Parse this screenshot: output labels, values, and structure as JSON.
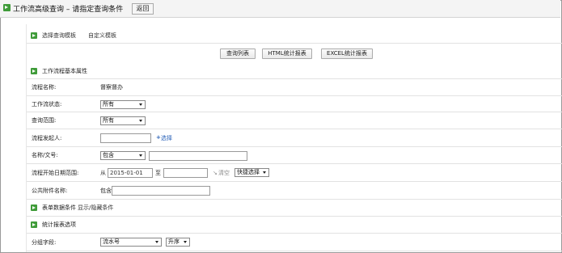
{
  "header": {
    "title": "工作流高级查询 – 请指定查询条件",
    "back_label": "返回"
  },
  "template_row": {
    "select_template": "选择查询模板",
    "custom_template": "自定义模板"
  },
  "actions": {
    "query_list": "查询列表",
    "html_report": "HTML统计报表",
    "excel_report": "EXCEL统计报表"
  },
  "basic_section": {
    "title": "工作流程基本属性"
  },
  "form": {
    "flow_name_label": "流程名称:",
    "flow_name_value": "督察督办",
    "status_label": "工作流状态:",
    "status_value": "所有",
    "scope_label": "查询范围:",
    "scope_value": "所有",
    "initiator_label": "流程发起人:",
    "initiator_value": "",
    "initiator_select_label": "选择",
    "name_label": "名称/文号:",
    "name_match_value": "包含",
    "name_value": "",
    "start_date_label": "流程开始日期范围:",
    "from_label": "从",
    "from_value": "2015-01-01",
    "to_label": "至",
    "to_value": "",
    "clear_label": "清空",
    "quick_select_value": "快捷选择",
    "attachment_label": "公共附件名称:",
    "attachment_match": "包含",
    "attachment_value": ""
  },
  "form_conditions": {
    "title": "表单数据条件",
    "toggle_label": "显示/隐藏条件"
  },
  "stats_section": {
    "title": "统计报表选项"
  },
  "group": {
    "label": "分组字段:",
    "field_value": "流水号",
    "order_value": "升序"
  }
}
